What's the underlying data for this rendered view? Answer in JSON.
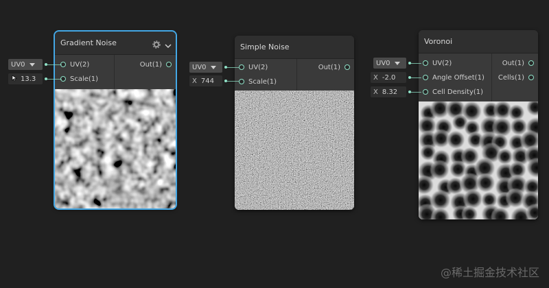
{
  "nodes": {
    "gradient": {
      "title": "Gradient Noise",
      "inputs": [
        "UV(2)",
        "Scale(1)"
      ],
      "outputs": [
        "Out(1)"
      ],
      "uv_value": "UV0",
      "scale_value": "13.3"
    },
    "simple": {
      "title": "Simple Noise",
      "inputs": [
        "UV(2)",
        "Scale(1)"
      ],
      "outputs": [
        "Out(1)"
      ],
      "uv_value": "UV0",
      "scale_label": "X",
      "scale_value": "744"
    },
    "voronoi": {
      "title": "Voronoi",
      "inputs": [
        "UV(2)",
        "Angle Offset(1)",
        "Cell Density(1)"
      ],
      "outputs": [
        "Out(1)",
        "Cells(1)"
      ],
      "uv_value": "UV0",
      "angle_label": "X",
      "angle_value": "-2.0",
      "density_label": "X",
      "density_value": "8.32"
    }
  },
  "watermark": "@稀土掘金技术社区",
  "colors": {
    "accent": "#44a8e6",
    "port": "#8fe1c7",
    "background": "#202020"
  }
}
